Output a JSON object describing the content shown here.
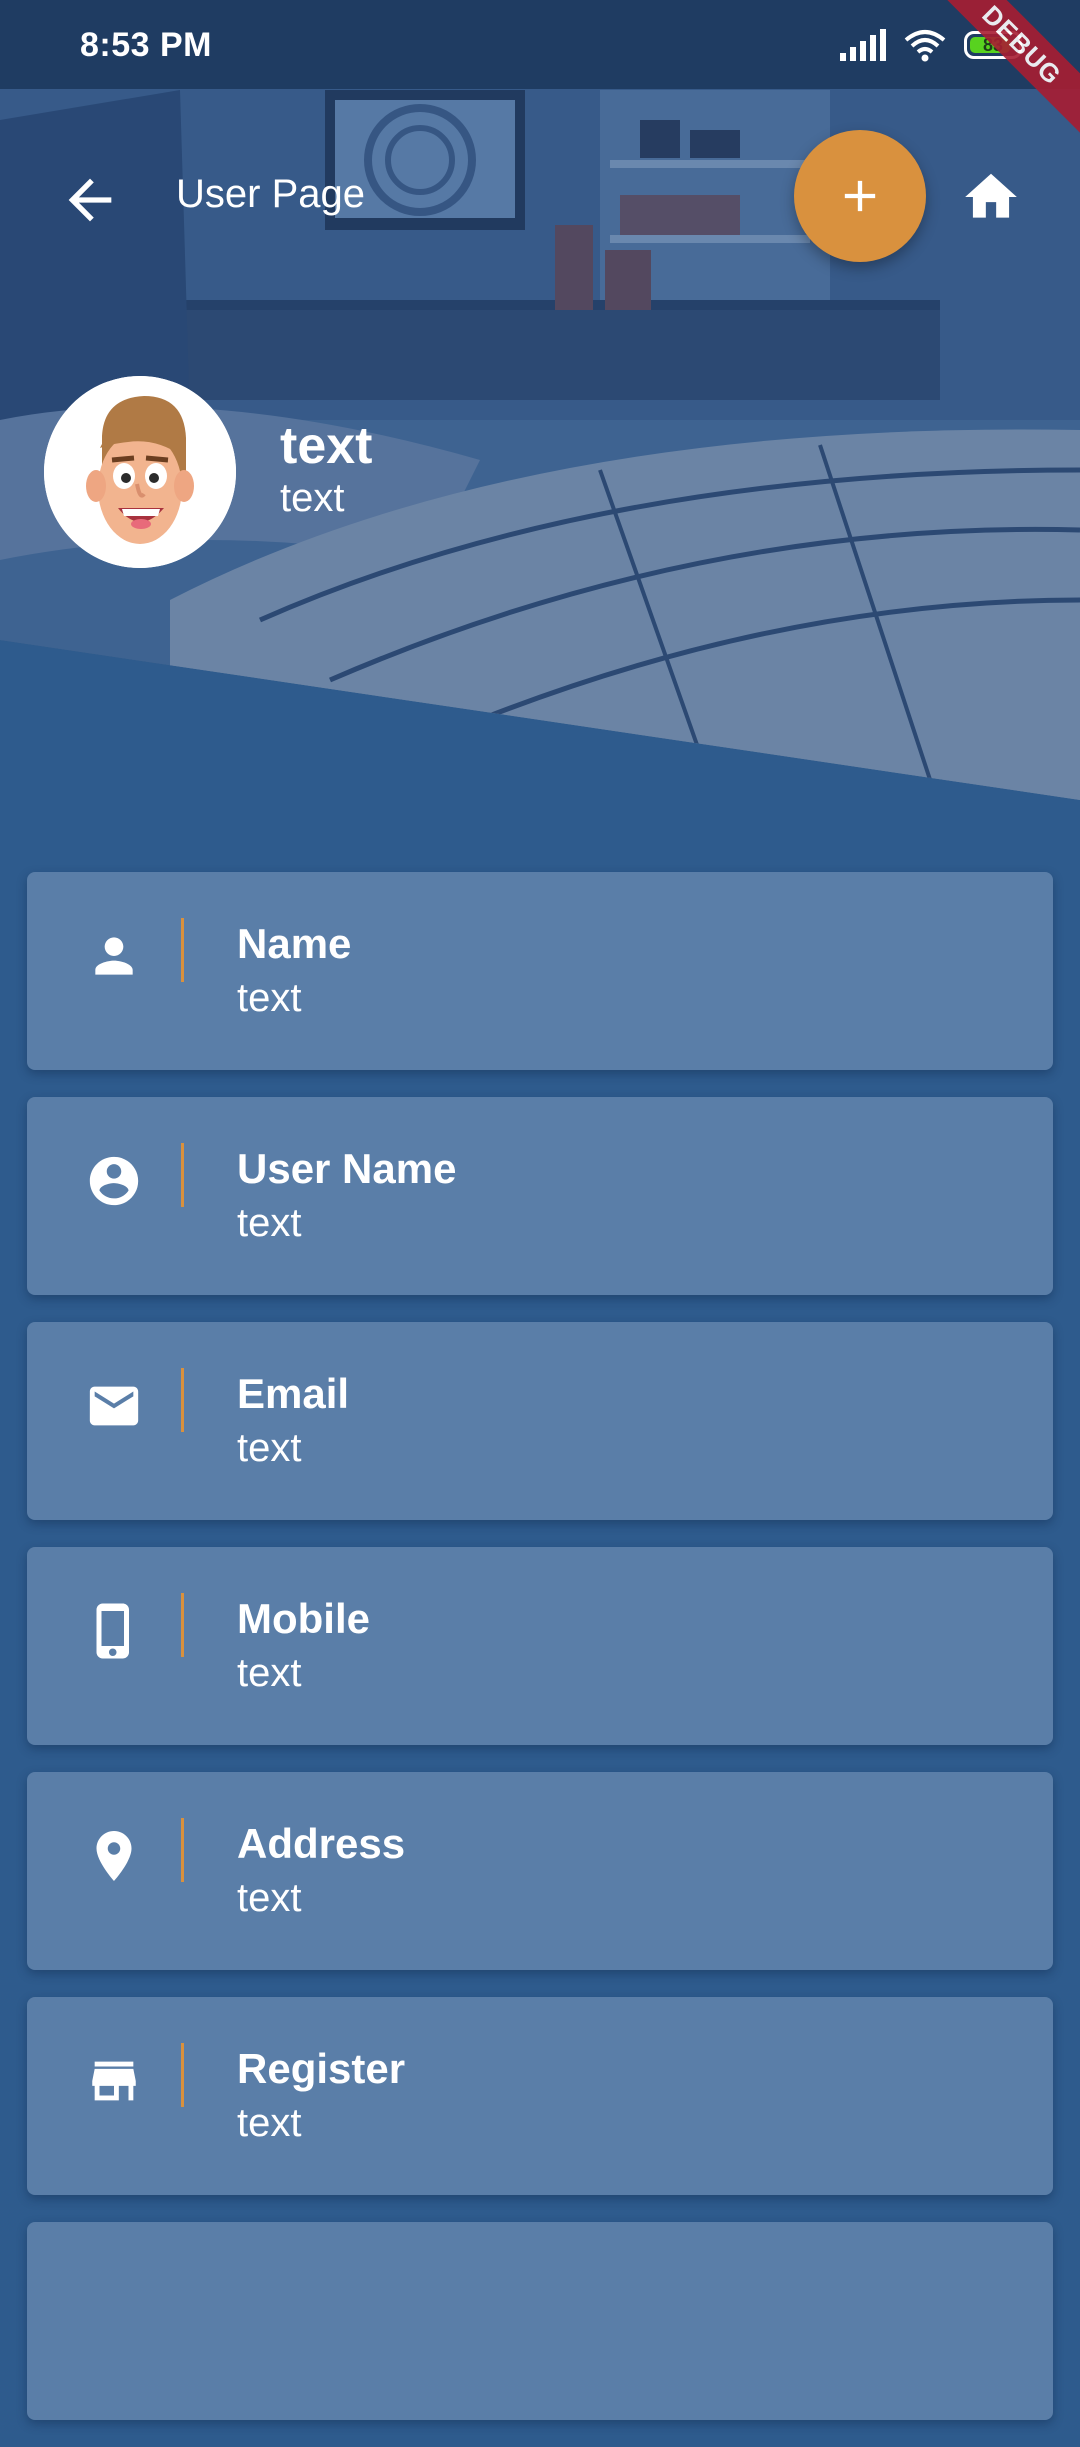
{
  "status_bar": {
    "time": "8:53 PM",
    "battery_level": "83",
    "signal_icon": "signal-icon",
    "wifi_icon": "wifi-icon"
  },
  "debug_banner": "DEBUG",
  "app_bar": {
    "title": "User Page",
    "back_icon": "arrow-back-icon",
    "add_icon": "add-icon",
    "home_icon": "home-icon"
  },
  "profile": {
    "name": "text",
    "subtitle": "text"
  },
  "fields": [
    {
      "label": "Name",
      "value": "text",
      "icon": "person-icon"
    },
    {
      "label": "User Name",
      "value": "text",
      "icon": "account-circle-icon"
    },
    {
      "label": "Email",
      "value": "text",
      "icon": "email-icon"
    },
    {
      "label": "Mobile",
      "value": "text",
      "icon": "phone-icon"
    },
    {
      "label": "Address",
      "value": "text",
      "icon": "location-pin-icon"
    },
    {
      "label": "Register",
      "value": "text",
      "icon": "store-icon"
    }
  ],
  "colors": {
    "background": "#2e5b8d",
    "card": "#5a7ea8",
    "accent": "#d9913e",
    "status_bar": "#1f3c62"
  }
}
